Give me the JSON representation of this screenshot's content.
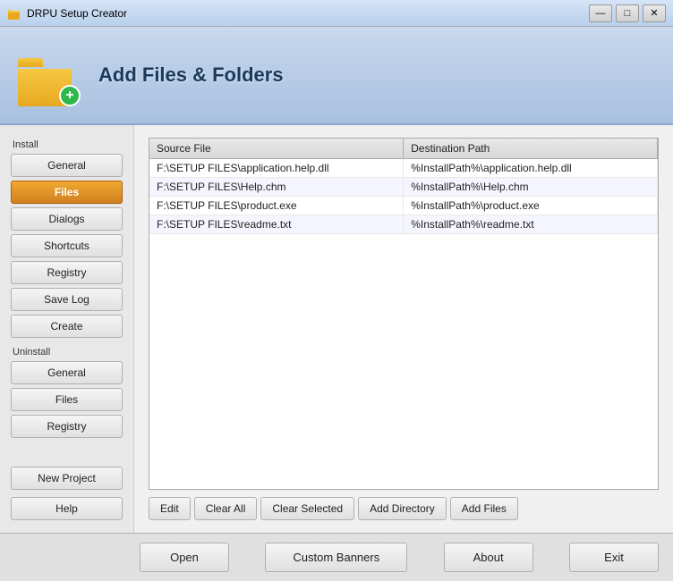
{
  "window": {
    "title": "DRPU Setup Creator",
    "controls": {
      "minimize": "—",
      "maximize": "□",
      "close": "✕"
    }
  },
  "header": {
    "title": "Add Files & Folders"
  },
  "sidebar": {
    "install_label": "Install",
    "uninstall_label": "Uninstall",
    "install_buttons": [
      {
        "label": "General",
        "active": false
      },
      {
        "label": "Files",
        "active": true
      },
      {
        "label": "Dialogs",
        "active": false
      },
      {
        "label": "Shortcuts",
        "active": false
      },
      {
        "label": "Registry",
        "active": false
      },
      {
        "label": "Save Log",
        "active": false
      },
      {
        "label": "Create",
        "active": false
      }
    ],
    "uninstall_buttons": [
      {
        "label": "General",
        "active": false
      },
      {
        "label": "Files",
        "active": false
      },
      {
        "label": "Registry",
        "active": false
      }
    ],
    "bottom_buttons": [
      {
        "label": "New Project"
      },
      {
        "label": "Help"
      }
    ]
  },
  "table": {
    "columns": [
      "Source File",
      "Destination Path"
    ],
    "rows": [
      {
        "source": "F:\\SETUP FILES\\application.help.dll",
        "dest": "%InstallPath%\\application.help.dll"
      },
      {
        "source": "F:\\SETUP FILES\\Help.chm",
        "dest": "%InstallPath%\\Help.chm"
      },
      {
        "source": "F:\\SETUP FILES\\product.exe",
        "dest": "%InstallPath%\\product.exe"
      },
      {
        "source": "F:\\SETUP FILES\\readme.txt",
        "dest": "%InstallPath%\\readme.txt"
      }
    ]
  },
  "action_buttons": {
    "edit": "Edit",
    "clear_all": "Clear All",
    "clear_selected": "Clear Selected",
    "add_directory": "Add Directory",
    "add_files": "Add Files"
  },
  "bottom_buttons": {
    "open": "Open",
    "custom_banners": "Custom Banners",
    "about": "About",
    "exit": "Exit"
  }
}
